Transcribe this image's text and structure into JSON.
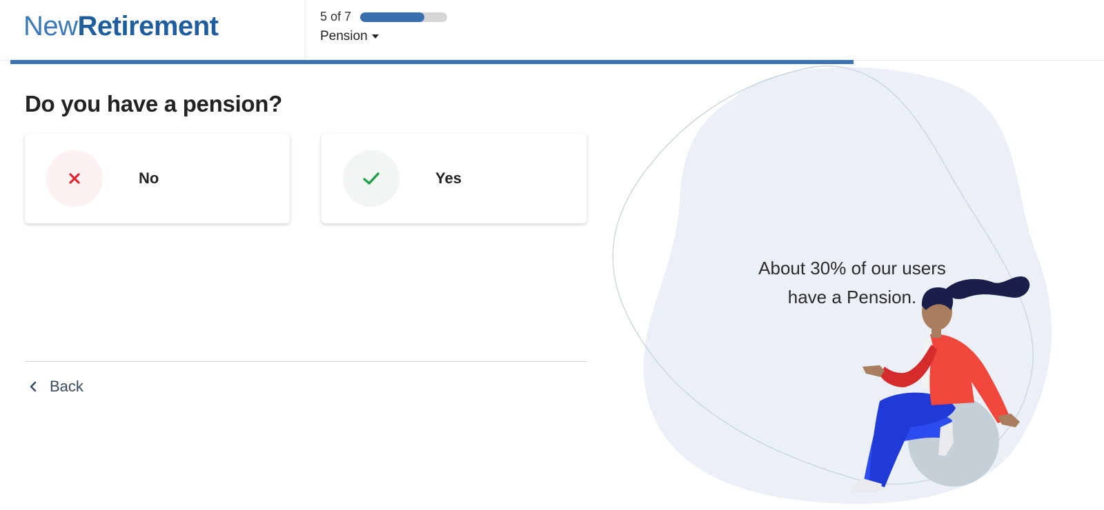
{
  "logo": {
    "light": "New",
    "bold": "Retirement"
  },
  "progress": {
    "step_label": "5 of 7",
    "step_fraction": 0.74,
    "overall_fraction": 0.764
  },
  "section": {
    "label": "Pension"
  },
  "question": {
    "title": "Do you have a pension?"
  },
  "options": [
    {
      "label": "No",
      "icon": "x-icon",
      "color": "#e0242f"
    },
    {
      "label": "Yes",
      "icon": "check-icon",
      "color": "#1e9e4a"
    }
  ],
  "navigation": {
    "back_label": "Back"
  },
  "tip": {
    "line1": "About 30% of our users",
    "line2": "have a Pension."
  },
  "colors": {
    "brand_blue": "#1f5d9e",
    "progress_blue": "#3a72b4",
    "blob": "#ebf0f6",
    "jacket": "#f0463c",
    "pants": "#2d4cf0",
    "ball": "#c5cfd8",
    "hair": "#1a1f4a",
    "skin": "#a87e5e"
  }
}
